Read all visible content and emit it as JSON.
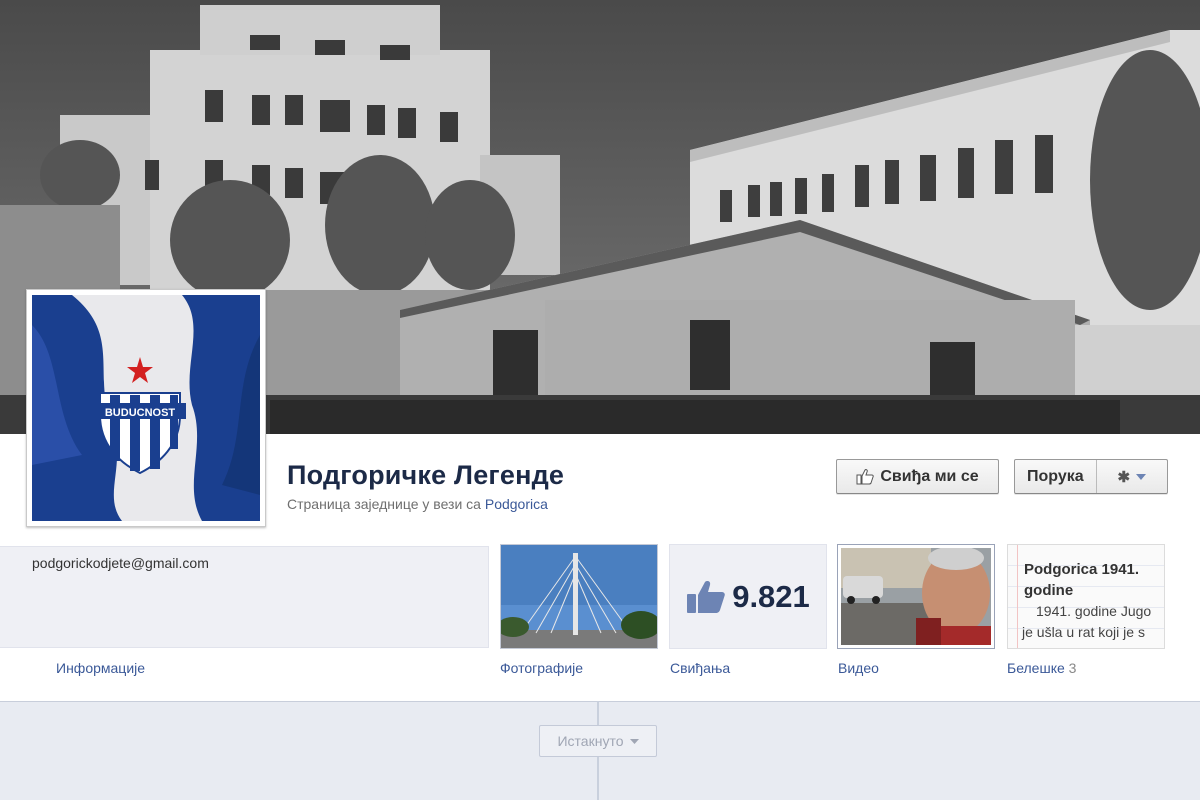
{
  "page": {
    "title": "Подгоричке Легенде",
    "subtitle_prefix": "Страница заједнице у вези са",
    "subtitle_link": "Podgorica"
  },
  "actions": {
    "like_label": "Свиђа ми се",
    "message_label": "Порука"
  },
  "info": {
    "email": "podgorickodjete@gmail.com",
    "label": "Информације"
  },
  "apps": {
    "photos_label": "Фотографије",
    "likes_label": "Свиђања",
    "likes_count": "9.821",
    "video_label": "Видео",
    "notes_label": "Белешке",
    "notes_count": "3",
    "note_title_line1": "Podgorica 1941.",
    "note_title_line2": "godine",
    "note_body_line1": "1941. godine Jugo",
    "note_body_line2": "je ušla u rat koji je s"
  },
  "timeline": {
    "highlight_label": "Истакнуто"
  },
  "colors": {
    "link": "#3b5998",
    "title": "#1c2a47",
    "panel": "#eff0f5"
  }
}
